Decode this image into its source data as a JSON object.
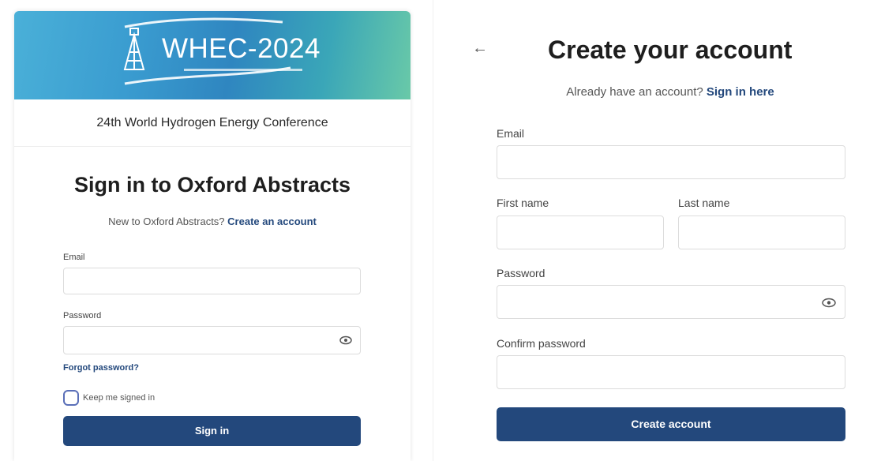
{
  "signin": {
    "banner_title": "WHEC-2024",
    "conference_name": "24th World Hydrogen Energy Conference",
    "title": "Sign in to Oxford Abstracts",
    "new_prefix": "New to Oxford Abstracts? ",
    "create_link": "Create an account",
    "email_label": "Email",
    "email_value": "",
    "password_label": "Password",
    "password_value": "",
    "forgot_link": "Forgot password?",
    "keep_signed_in": "Keep me signed in",
    "keep_signed_in_checked": false,
    "submit_label": "Sign in"
  },
  "create": {
    "back_icon": "arrow-left-icon",
    "title": "Create your account",
    "already_prefix": "Already have an account? ",
    "signin_link": "Sign in here",
    "email_label": "Email",
    "first_name_label": "First name",
    "last_name_label": "Last name",
    "password_label": "Password",
    "confirm_password_label": "Confirm password",
    "submit_label": "Create account"
  },
  "colors": {
    "primary": "#23487c",
    "link": "#23487c",
    "input_border": "#dcdcdc",
    "checkbox_border": "#5a6fb8"
  }
}
